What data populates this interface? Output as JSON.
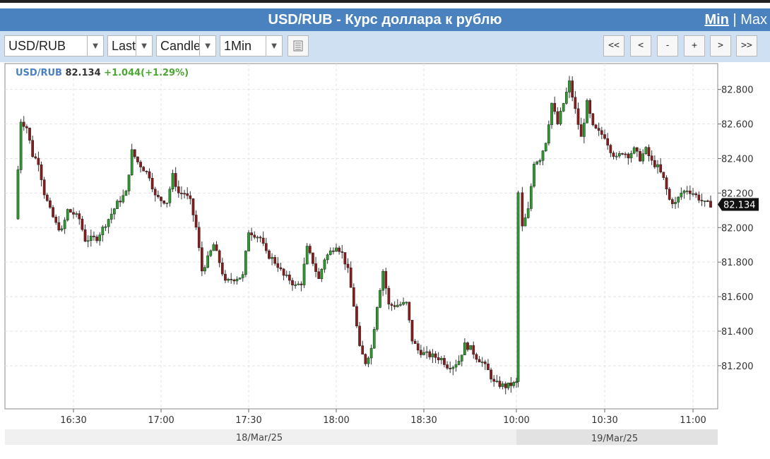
{
  "title": "USD/RUB - Курс доллара к рублю",
  "range_links": {
    "min": "Min",
    "separator": "|",
    "max": "Max"
  },
  "toolbar": {
    "symbol": "USD/RUB",
    "price_field": "Last",
    "chart_type": "Candle",
    "interval": "1Min",
    "nav": [
      "<<",
      "<",
      "-",
      "+",
      ">",
      ">>"
    ]
  },
  "legend": {
    "symbol": "USD/RUB",
    "last": "82.134",
    "change": "+1.044(+1.29%)"
  },
  "colors": {
    "up": "#2a9d2a",
    "down": "#8b1a1a",
    "titlebar": "#4a82c0",
    "toolbar": "#cfe0f3"
  },
  "chart_data": {
    "type": "candlestick",
    "ylim": [
      80.95,
      82.95
    ],
    "y_ticks": [
      "82.800",
      "82.600",
      "82.400",
      "82.200",
      "82.000",
      "81.800",
      "81.600",
      "81.400",
      "81.200"
    ],
    "x_ticks": [
      "16:30",
      "17:00",
      "17:30",
      "18:00",
      "18:30",
      "10:00",
      "10:30",
      "11:00"
    ],
    "dates": [
      "18/Mar/25",
      "19/Mar/25"
    ],
    "last_price_label": "82.134",
    "grid": true,
    "price_path": [
      {
        "t": "16:10",
        "p": 82.05
      },
      {
        "t": "16:12",
        "p": 82.62
      },
      {
        "t": "16:14",
        "p": 82.58
      },
      {
        "t": "16:16",
        "p": 82.42
      },
      {
        "t": "16:18",
        "p": 82.38
      },
      {
        "t": "16:20",
        "p": 82.2
      },
      {
        "t": "16:22",
        "p": 82.1
      },
      {
        "t": "16:24",
        "p": 82.02
      },
      {
        "t": "16:26",
        "p": 81.98
      },
      {
        "t": "16:28",
        "p": 82.1
      },
      {
        "t": "16:30",
        "p": 82.08
      },
      {
        "t": "16:32",
        "p": 82.05
      },
      {
        "t": "16:34",
        "p": 81.93
      },
      {
        "t": "16:38",
        "p": 81.94
      },
      {
        "t": "16:42",
        "p": 82.05
      },
      {
        "t": "16:45",
        "p": 82.14
      },
      {
        "t": "16:48",
        "p": 82.2
      },
      {
        "t": "16:50",
        "p": 82.44
      },
      {
        "t": "16:52",
        "p": 82.38
      },
      {
        "t": "16:54",
        "p": 82.34
      },
      {
        "t": "16:56",
        "p": 82.3
      },
      {
        "t": "16:58",
        "p": 82.18
      },
      {
        "t": "17:00",
        "p": 82.16
      },
      {
        "t": "17:02",
        "p": 82.15
      },
      {
        "t": "17:04",
        "p": 82.3
      },
      {
        "t": "17:06",
        "p": 82.2
      },
      {
        "t": "17:08",
        "p": 82.2
      },
      {
        "t": "17:10",
        "p": 82.15
      },
      {
        "t": "17:12",
        "p": 82.0
      },
      {
        "t": "17:14",
        "p": 81.75
      },
      {
        "t": "17:16",
        "p": 81.82
      },
      {
        "t": "17:18",
        "p": 81.9
      },
      {
        "t": "17:20",
        "p": 81.8
      },
      {
        "t": "17:22",
        "p": 81.68
      },
      {
        "t": "17:24",
        "p": 81.7
      },
      {
        "t": "17:28",
        "p": 81.72
      },
      {
        "t": "17:30",
        "p": 81.98
      },
      {
        "t": "17:32",
        "p": 81.96
      },
      {
        "t": "17:34",
        "p": 81.94
      },
      {
        "t": "17:36",
        "p": 81.85
      },
      {
        "t": "17:38",
        "p": 81.82
      },
      {
        "t": "17:40",
        "p": 81.78
      },
      {
        "t": "17:42",
        "p": 81.72
      },
      {
        "t": "17:44",
        "p": 81.7
      },
      {
        "t": "17:46",
        "p": 81.66
      },
      {
        "t": "17:48",
        "p": 81.68
      },
      {
        "t": "17:50",
        "p": 81.88
      },
      {
        "t": "17:52",
        "p": 81.8
      },
      {
        "t": "17:54",
        "p": 81.7
      },
      {
        "t": "17:56",
        "p": 81.82
      },
      {
        "t": "18:00",
        "p": 81.9
      },
      {
        "t": "18:02",
        "p": 81.85
      },
      {
        "t": "18:04",
        "p": 81.75
      },
      {
        "t": "18:06",
        "p": 81.55
      },
      {
        "t": "18:08",
        "p": 81.3
      },
      {
        "t": "18:10",
        "p": 81.22
      },
      {
        "t": "18:12",
        "p": 81.3
      },
      {
        "t": "18:14",
        "p": 81.55
      },
      {
        "t": "18:16",
        "p": 81.75
      },
      {
        "t": "18:18",
        "p": 81.55
      },
      {
        "t": "18:20",
        "p": 81.55
      },
      {
        "t": "18:24",
        "p": 81.56
      },
      {
        "t": "18:26",
        "p": 81.35
      },
      {
        "t": "18:28",
        "p": 81.29
      },
      {
        "t": "18:30",
        "p": 81.27
      },
      {
        "t": "18:32",
        "p": 81.26
      },
      {
        "t": "18:34",
        "p": 81.25
      },
      {
        "t": "18:36",
        "p": 81.24
      },
      {
        "t": "18:38",
        "p": 81.2
      },
      {
        "t": "18:40",
        "p": 81.2
      },
      {
        "t": "18:42",
        "p": 81.23
      },
      {
        "t": "18:44",
        "p": 81.32
      },
      {
        "t": "18:46",
        "p": 81.3
      },
      {
        "t": "18:48",
        "p": 81.25
      },
      {
        "t": "18:50",
        "p": 81.22
      },
      {
        "t": "18:52",
        "p": 81.17
      },
      {
        "t": "18:54",
        "p": 81.1
      },
      {
        "t": "18:56",
        "p": 81.09
      },
      {
        "t": "18:58",
        "p": 81.08
      },
      {
        "t": "10:00",
        "p": 81.1
      },
      {
        "t": "10:00a",
        "p": 82.2
      },
      {
        "t": "10:02",
        "p": 82.0
      },
      {
        "t": "10:04",
        "p": 82.1
      },
      {
        "t": "10:06",
        "p": 82.38
      },
      {
        "t": "10:08",
        "p": 82.4
      },
      {
        "t": "10:10",
        "p": 82.5
      },
      {
        "t": "10:12",
        "p": 82.72
      },
      {
        "t": "10:14",
        "p": 82.6
      },
      {
        "t": "10:16",
        "p": 82.72
      },
      {
        "t": "10:18",
        "p": 82.84
      },
      {
        "t": "10:20",
        "p": 82.68
      },
      {
        "t": "10:22",
        "p": 82.52
      },
      {
        "t": "10:24",
        "p": 82.72
      },
      {
        "t": "10:26",
        "p": 82.58
      },
      {
        "t": "10:28",
        "p": 82.55
      },
      {
        "t": "10:30",
        "p": 82.53
      },
      {
        "t": "10:32",
        "p": 82.45
      },
      {
        "t": "10:34",
        "p": 82.4
      },
      {
        "t": "10:36",
        "p": 82.44
      },
      {
        "t": "10:38",
        "p": 82.42
      },
      {
        "t": "10:40",
        "p": 82.45
      },
      {
        "t": "10:42",
        "p": 82.4
      },
      {
        "t": "10:44",
        "p": 82.45
      },
      {
        "t": "10:46",
        "p": 82.38
      },
      {
        "t": "10:48",
        "p": 82.35
      },
      {
        "t": "10:50",
        "p": 82.28
      },
      {
        "t": "10:52",
        "p": 82.16
      },
      {
        "t": "10:54",
        "p": 82.14
      },
      {
        "t": "10:56",
        "p": 82.2
      },
      {
        "t": "10:58",
        "p": 82.22
      },
      {
        "t": "11:00",
        "p": 82.2
      },
      {
        "t": "11:02",
        "p": 82.17
      },
      {
        "t": "11:04",
        "p": 82.14
      },
      {
        "t": "11:06",
        "p": 82.134
      }
    ]
  }
}
